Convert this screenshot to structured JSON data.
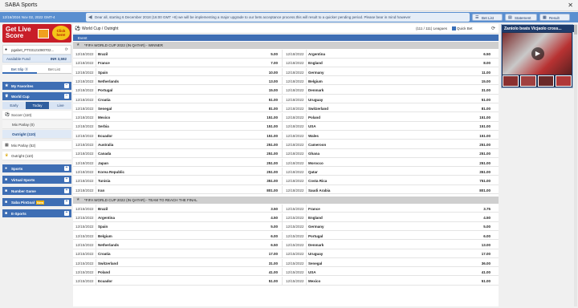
{
  "window": {
    "title": "SABA Sports",
    "close": "✕"
  },
  "topbar": {
    "time": "12/16/2024 Nov 02, 2022 GMT-4",
    "announcement": "Dear all, starting 6 December 2018 (16:00 GMT +8) we will be implementing a major upgrade to our bets acceptance process.this will result to a quicker pending period. Please bear in mind however",
    "buttons": [
      {
        "icon": "list-icon",
        "glyph": "☰",
        "label": "Bet List"
      },
      {
        "icon": "statement-icon",
        "glyph": "▤",
        "label": "Statement"
      },
      {
        "icon": "result-icon",
        "glyph": "▦",
        "label": "Result"
      }
    ]
  },
  "left": {
    "promo": {
      "line1": "Get Live",
      "line2": "Score",
      "badge": "Click here!"
    },
    "account": {
      "user": "pgabet_PT03121080702...",
      "refresh": "⟳"
    },
    "fund": {
      "label": "Available Fund",
      "value": "INR 3,592"
    },
    "tabs": [
      "Bet Slip ⓪",
      "Bet List"
    ],
    "favorites": "My Favorites",
    "worldcup": "World Cup",
    "worldcup_tabs": [
      "Early",
      "Today",
      "Live"
    ],
    "soccer": "Soccer (110)",
    "mixparlay_sub": "Mix Parlay (0)",
    "outright_sub": "Outright (110)",
    "mixparlay": "Mix Parlay (52)",
    "outright": "Outright (110)",
    "sections": [
      "Sports",
      "Virtual Sports",
      "Number Game",
      "Saba PinGoal",
      "E-Sports"
    ],
    "hot": "New"
  },
  "center": {
    "title": "World Cup / Outright",
    "leagues": "(111 / 111) Leagues",
    "quick_bet": "Quick Bet",
    "event_header": "Event",
    "groups": [
      {
        "name": "*FIFA WORLD CUP 2022 (IN QATAR) - WINNER",
        "rows": [
          [
            "12/18/2022",
            "Brazil",
            "5.00",
            "12/18/2022",
            "Argentina",
            "6.50"
          ],
          [
            "12/18/2022",
            "France",
            "7.00",
            "12/18/2022",
            "England",
            "8.00"
          ],
          [
            "12/18/2022",
            "Spain",
            "10.00",
            "12/18/2022",
            "Germany",
            "11.00"
          ],
          [
            "12/18/2022",
            "Netherlands",
            "13.00",
            "12/18/2022",
            "Belgium",
            "15.00"
          ],
          [
            "12/18/2022",
            "Portugal",
            "15.00",
            "12/18/2022",
            "Denmark",
            "31.00"
          ],
          [
            "12/18/2022",
            "Croatia",
            "51.00",
            "12/18/2022",
            "Uruguay",
            "51.00"
          ],
          [
            "12/18/2022",
            "Senegal",
            "81.00",
            "12/18/2022",
            "Switzerland",
            "81.00"
          ],
          [
            "12/18/2022",
            "Mexico",
            "151.00",
            "12/18/2022",
            "Poland",
            "151.00"
          ],
          [
            "12/18/2022",
            "Serbia",
            "151.00",
            "12/18/2022",
            "USA",
            "151.00"
          ],
          [
            "12/18/2022",
            "Ecuador",
            "151.00",
            "12/18/2022",
            "Wales",
            "151.00"
          ],
          [
            "12/18/2022",
            "Australia",
            "251.00",
            "12/18/2022",
            "Cameroon",
            "251.00"
          ],
          [
            "12/18/2022",
            "Canada",
            "251.00",
            "12/18/2022",
            "Ghana",
            "251.00"
          ],
          [
            "12/18/2022",
            "Japan",
            "251.00",
            "12/18/2022",
            "Morocco",
            "251.00"
          ],
          [
            "12/18/2022",
            "Korea Republic",
            "251.00",
            "12/18/2022",
            "Qatar",
            "351.00"
          ],
          [
            "12/18/2022",
            "Tunisia",
            "351.00",
            "12/18/2022",
            "Costa Rica",
            "751.00"
          ],
          [
            "12/18/2022",
            "Iran",
            "801.00",
            "12/18/2022",
            "Saudi Arabia",
            "801.00"
          ]
        ]
      },
      {
        "name": "*FIFA WORLD CUP 2022 (IN QATAR) - TEAM TO REACH THE FINAL",
        "rows": [
          [
            "12/15/2022",
            "Brazil",
            "3.50",
            "12/15/2022",
            "France",
            "3.75"
          ],
          [
            "12/15/2022",
            "Argentina",
            "4.50",
            "12/15/2022",
            "England",
            "4.50"
          ],
          [
            "12/15/2022",
            "Spain",
            "5.00",
            "12/15/2022",
            "Germany",
            "5.00"
          ],
          [
            "12/15/2022",
            "Belgium",
            "6.00",
            "12/15/2022",
            "Portugal",
            "6.00"
          ],
          [
            "12/15/2022",
            "Netherlands",
            "6.50",
            "12/15/2022",
            "Denmark",
            "13.00"
          ],
          [
            "12/15/2022",
            "Croatia",
            "17.00",
            "12/15/2022",
            "Uruguay",
            "17.00"
          ],
          [
            "12/15/2022",
            "Switzerland",
            "31.00",
            "12/15/2022",
            "Senegal",
            "36.00"
          ],
          [
            "12/15/2022",
            "Poland",
            "41.00",
            "12/15/2022",
            "USA",
            "41.00"
          ],
          [
            "12/15/2022",
            "Ecuador",
            "51.00",
            "12/15/2022",
            "Mexico",
            "51.00"
          ]
        ]
      }
    ]
  },
  "right": {
    "headline": "Zaniolo beats Vicjaolo cross...",
    "play": "▶"
  },
  "colors": {
    "accent": "#3e6eb4",
    "topbar": "#5a8fd0",
    "promo": "#c81e28"
  }
}
